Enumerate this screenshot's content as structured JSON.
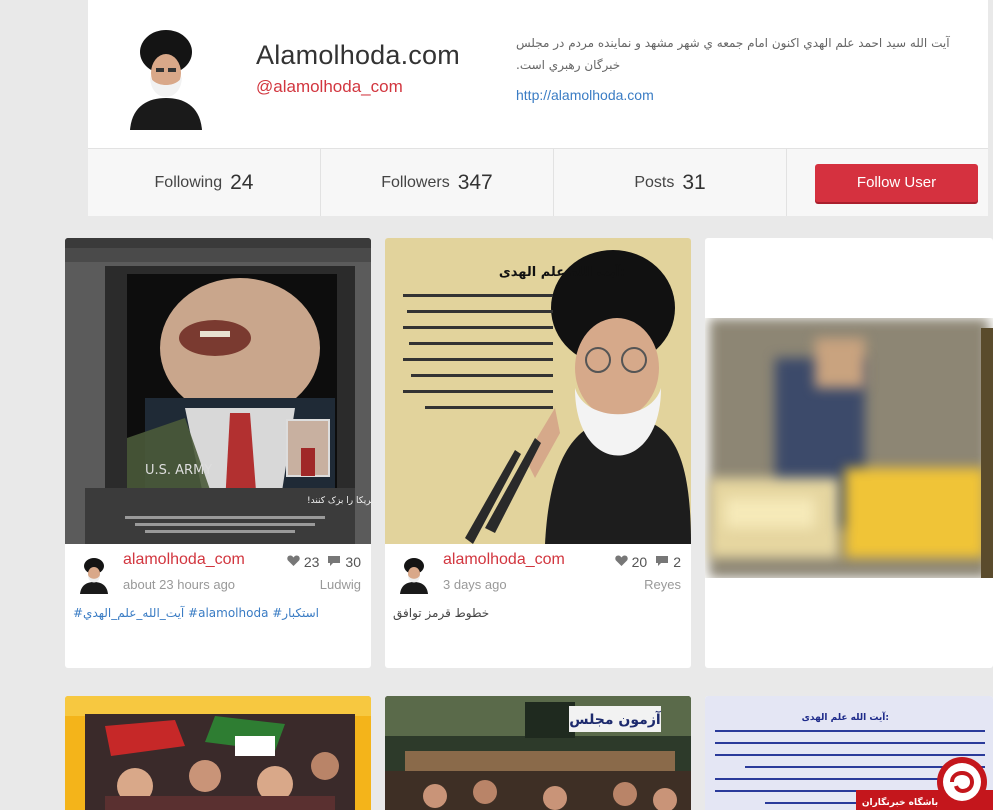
{
  "profile": {
    "name": "Alamolhoda.com",
    "handle": "@alamolhoda_com",
    "bio": "آیت الله سید احمد علم الهدي اکنون امام جمعه ي شهر مشهد و نماينده مردم در مجلس خبرگان رهبري است.",
    "website": "http://alamolhoda.com"
  },
  "stats": {
    "following_label": "Following",
    "following_value": "24",
    "followers_label": "Followers",
    "followers_value": "347",
    "posts_label": "Posts",
    "posts_value": "31",
    "follow_button": "Follow User"
  },
  "cards": [
    {
      "user": "alamolhoda_com",
      "time": "about 23 hours ago",
      "likes": "23",
      "comments": "30",
      "author": "Ludwig",
      "caption": "استکبار# alamolhoda# آیت_الله_علم_الهدي#",
      "image_title": "عده‌ای سعی نکنند چهره‌ی آمریکا را بزک کنند!",
      "image_subtitle": "U.S. ARMY"
    },
    {
      "user": "alamolhoda_com",
      "time": "3 days ago",
      "likes": "20",
      "comments": "2",
      "author": "Reyes",
      "caption": "خطوط قرمز توافق",
      "image_heading": "آیت الله علم الهدی:",
      "image_text": "خطوط قرمزی که رهبری برای توافق تعیین کردند خواسته شخص رهبری نیست بلکه مصالح این کشور است که با حکمت خاصی که دارند و مسئولیتی که از نظر حجت امام زمان(عج) در این نظام عهده دار هستند، در تأمین مصالح مردم این خطوط را مشخص کرده اند و نمایندگان مجلس باید به این نکته توجه کنند."
    }
  ],
  "bottom_cards": {
    "middle_label": "آزمون مجلس",
    "right_heading": "آیت الله علم الهدی:",
    "right_text": "ستاخیز گرفتم و به رئیس سازمان سینمایی کشور دادم، راه داشت که به رستاخیز شد دوباره اتفاق نیفتد به دست خود ساخت یک فیلم از یک فقیه ، فیلسوف و کلام دان ، مفسر و"
  },
  "watermark": {
    "text": "باشگاه خبرنگاران"
  },
  "colors": {
    "accent": "#d5313f",
    "link": "#3a7cc4",
    "background": "#e9e9e9"
  }
}
